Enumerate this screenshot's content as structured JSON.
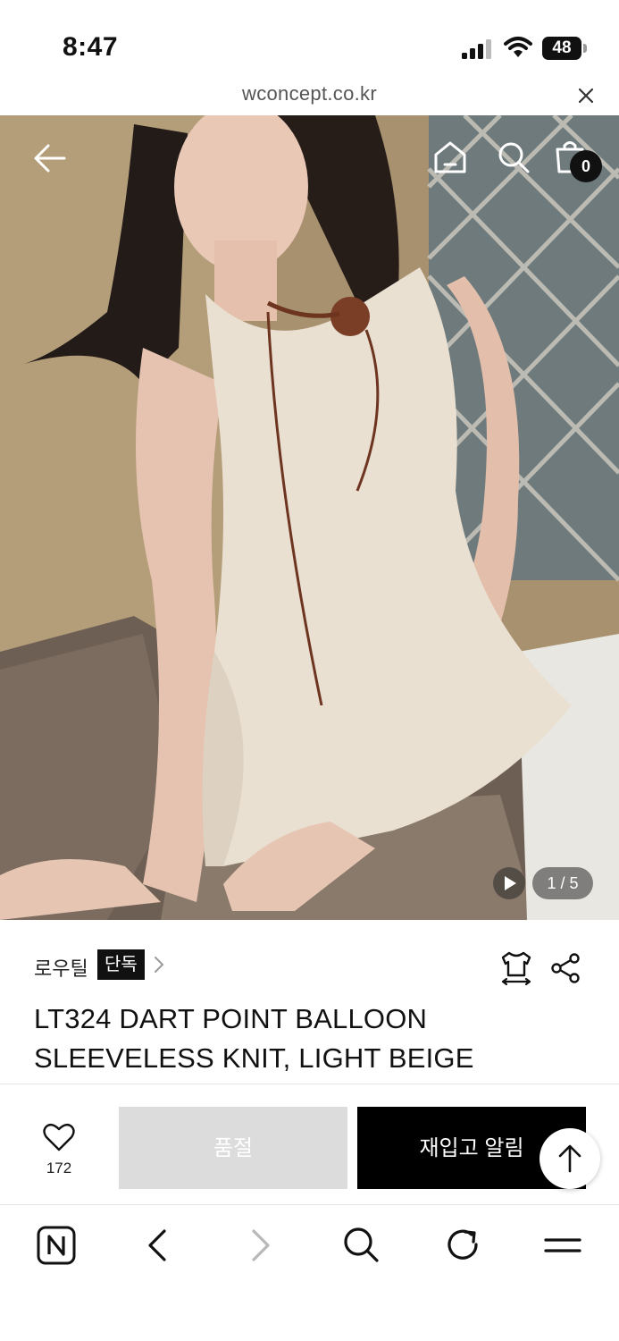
{
  "status_bar": {
    "time": "8:47",
    "battery": "48"
  },
  "browser": {
    "url": "wconcept.co.kr"
  },
  "header": {
    "back_icon": "arrow-left-icon",
    "home_icon": "home-icon",
    "search_icon": "search-icon",
    "cart_icon": "shopping-bag-icon",
    "cart_count": "0"
  },
  "gallery": {
    "counter": "1 / 5"
  },
  "product": {
    "brand": "로우틸",
    "exclusive_badge": "단독",
    "title": "LT324 DART POINT BALLOON SLEEVELESS KNIT, LIGHT BEIGE"
  },
  "actions": {
    "like_count": "172",
    "soldout_label": "품절",
    "restock_label": "재입고 알림"
  },
  "bottom_nav": {
    "items": [
      "n-logo-icon",
      "back-icon",
      "forward-icon",
      "search-icon",
      "refresh-icon",
      "menu-icon"
    ]
  },
  "colors": {
    "accent": "#000000",
    "soldout": "#dcdcdc"
  }
}
